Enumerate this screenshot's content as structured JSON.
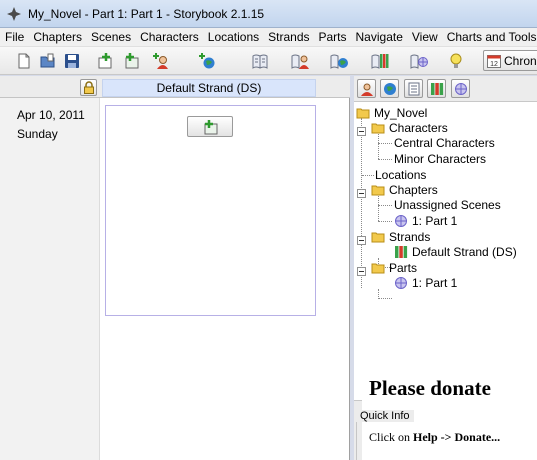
{
  "window": {
    "title": "My_Novel - Part 1: Part 1 - Storybook 2.1.15"
  },
  "menu": [
    "File",
    "Chapters",
    "Scenes",
    "Characters",
    "Locations",
    "Strands",
    "Parts",
    "Navigate",
    "View",
    "Charts and Tools"
  ],
  "toolbar": {
    "icons": [
      "new-file-icon",
      "open-folder-icon",
      "save-disk-icon",
      "new-chapter-icon",
      "new-scene-icon",
      "new-character-icon",
      "new-location-icon",
      "chapter-book-icon",
      "character-book-icon",
      "location-book-icon",
      "strand-book-icon",
      "part-book-icon",
      "idea-bulb-icon"
    ],
    "chrono_label": "Chron"
  },
  "strand_view": {
    "strand_name": "Default Strand (DS)",
    "date": "Apr 10, 2011",
    "weekday": "Sunday"
  },
  "tree": {
    "root": "My_Novel",
    "characters": "Characters",
    "central_characters": "Central Characters",
    "minor_characters": "Minor Characters",
    "locations": "Locations",
    "chapters": "Chapters",
    "unassigned_scenes": "Unassigned Scenes",
    "unassigned_part": "1: Part 1",
    "strands": "Strands",
    "default_strand": "Default Strand (DS)",
    "parts": "Parts",
    "part_1": "1: Part 1"
  },
  "quick_info": {
    "title": "Quick Info",
    "heading": "Please donate",
    "text_prefix": "Click on ",
    "text_bold": "Help -> Donate..."
  },
  "colors": {
    "strand_tab": "#d9e5fb",
    "scene_box_border": "#b7b0e6",
    "folder": "#f2c94c"
  }
}
